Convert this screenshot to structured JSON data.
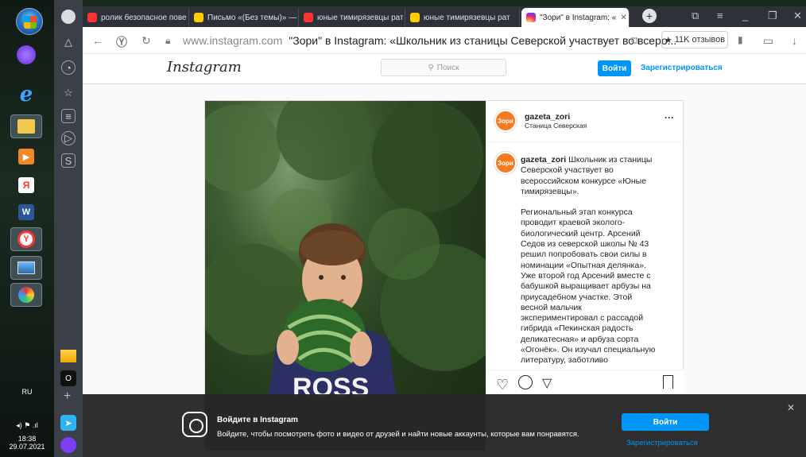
{
  "os": {
    "language": "RU",
    "time": "18:38",
    "date": "29.07.2021"
  },
  "tabs": [
    {
      "label": "ролик безопасное пове",
      "icon": "yandex-icon",
      "color": "#ff3333"
    },
    {
      "label": "Письмо «(Без темы)» —",
      "icon": "mail-icon",
      "color": "#ffcc00"
    },
    {
      "label": "юные тимирязевцы рат",
      "icon": "yandex-icon",
      "color": "#ff3333"
    },
    {
      "label": "юные тимирязевцы рат",
      "icon": "images-icon",
      "color": "#ffcc00"
    },
    {
      "label": "\"Зори\" в Instagram: «",
      "icon": "instagram-icon",
      "color": "#e1306c",
      "active": true
    }
  ],
  "address": {
    "url": "www.instagram.com",
    "title": "\"Зори\" в Instagram: «Школьник из станицы Северской участвует во всеро...",
    "reviews": "11K отзывов"
  },
  "instagram": {
    "logo": "Instagram",
    "search_placeholder": "Поиск",
    "login": "Войти",
    "register": "Зарегистрироваться"
  },
  "post": {
    "username": "gazeta_zori",
    "location": "Станица Северская",
    "avatar_text": "Зори",
    "caption_user": "gazeta_zori",
    "caption_first": " Школьник из станицы Северской участвует во всероссийском конкурсе «Юные тимирязевцы».",
    "caption_body": "Региональный этап конкурса проводит краевой эколого-биологический центр. Арсений Седов из северской школы № 43 решил попробовать свои силы в номинации «Опытная делянка». Уже второй год Арсений вместе с бабушкой выращивает арбузы на приусадебном участке. Этой весной мальчик экспериментировал с рассадой гибрида «Пекинская радость деликатесная» и арбуза сорта «Огонёк». Он изучал специальную литературу, заботливо"
  },
  "banner": {
    "title": "Войдите в Instagram",
    "text": "Войдите, чтобы посмотреть фото и видео от друзей и найти новые аккаунты, которые вам понравятся.",
    "login": "Войти",
    "register": "Зарегистрироваться"
  }
}
